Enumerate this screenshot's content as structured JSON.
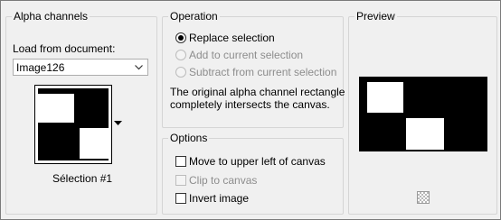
{
  "alpha_channels": {
    "title": "Alpha channels",
    "load_label": "Load from document:",
    "document_selected": "Image126",
    "channel_name": "Sélection #1"
  },
  "operation": {
    "title": "Operation",
    "options": [
      {
        "label": "Replace selection",
        "selected": true,
        "enabled": true
      },
      {
        "label": "Add to current selection",
        "selected": false,
        "enabled": false
      },
      {
        "label": "Subtract from current selection",
        "selected": false,
        "enabled": false
      }
    ],
    "info_line1": "The original alpha channel rectangle",
    "info_line2": "completely intersects the canvas."
  },
  "options": {
    "title": "Options",
    "items": [
      {
        "label": "Move to upper left of canvas",
        "checked": false,
        "enabled": true
      },
      {
        "label": "Clip to canvas",
        "checked": false,
        "enabled": false
      },
      {
        "label": "Invert image",
        "checked": false,
        "enabled": true
      }
    ]
  },
  "preview": {
    "title": "Preview",
    "zoom_icon": "checkerboard-icon"
  }
}
